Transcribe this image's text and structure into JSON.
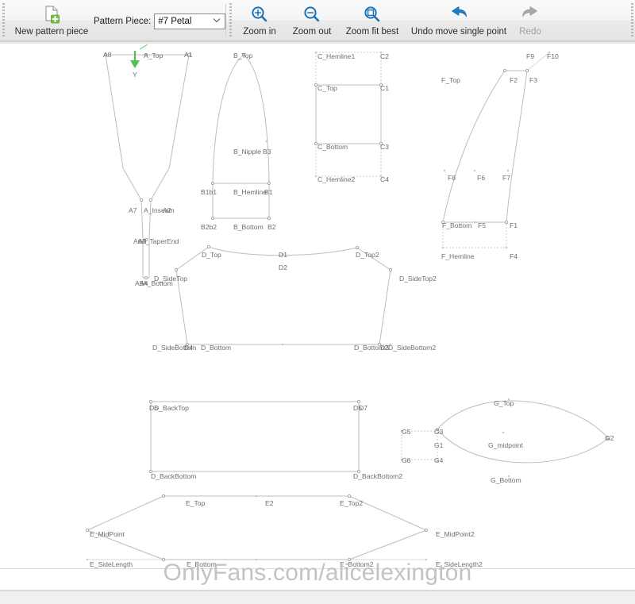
{
  "toolbar": {
    "new_piece": {
      "label": "New pattern piece",
      "icon": "new-page-plus-icon"
    },
    "piece_selector": {
      "label": "Pattern Piece:",
      "value": "#7 Petal",
      "caret_icon": "chevron-down-icon"
    },
    "zoom_in": {
      "label": "Zoom in",
      "icon": "magnifier-plus-icon"
    },
    "zoom_out": {
      "label": "Zoom out",
      "icon": "magnifier-minus-icon"
    },
    "zoom_fit": {
      "label": "Zoom fit best",
      "icon": "magnifier-fit-icon"
    },
    "undo": {
      "label": "Undo move single point",
      "icon": "undo-arrow-icon",
      "enabled": true
    },
    "redo": {
      "label": "Redo",
      "icon": "redo-arrow-icon",
      "enabled": false
    }
  },
  "colors": {
    "accent_blue": "#1a73b8",
    "disabled_gray": "#a2a2a2",
    "seam_line": "#bdbdbd",
    "label_text": "#6e6e6e",
    "axis_green": "#4fc24f",
    "watermark": "#c3c3c3"
  },
  "canvas": {
    "axis_marker": {
      "name": "Y",
      "direction": "down",
      "color": "#4fc24f"
    },
    "watermark": "OnlyFans.com/alicelexington",
    "labels": {
      "a": [
        "A8",
        "A_Top",
        "A1",
        "A7",
        "A_Inseam",
        "A2",
        "A6",
        "A3",
        "A_TaperEnd",
        "A5",
        "A4",
        "A_Bottom"
      ],
      "b": [
        "B_Top",
        "B_Nipple",
        "B3",
        "B1b1",
        "B_Hemline",
        "B1",
        "B2b2",
        "B_Bottom",
        "B2"
      ],
      "c": [
        "C_Hemline1",
        "C2",
        "C_Top",
        "C1",
        "C_Bottom",
        "C3",
        "C_Hemline2",
        "C4"
      ],
      "f": [
        "F9",
        "F10",
        "F_Top",
        "F2",
        "F3",
        "F8",
        "F6",
        "F7",
        "F_Bottom",
        "F5",
        "F1",
        "F_Hemline",
        "F4"
      ],
      "d": [
        "D_Top",
        "D1",
        "D_Top2",
        "D2",
        "D_SideTop",
        "D_SideTop2",
        "D_SideBottom",
        "D4",
        "D_Bottom",
        "D_Bottom2",
        "D3",
        "D_SideBottom2"
      ],
      "dback": [
        "D6",
        "D_BackTop",
        "D5",
        "D7",
        "D_BackBottom",
        "D_BackBottom2"
      ],
      "g": [
        "G5",
        "G3",
        "G1",
        "G6",
        "G4",
        "G_Top",
        "G_midpoint",
        "G2",
        "G_Bottom"
      ],
      "e": [
        "E_Top",
        "E2",
        "E_Top2",
        "E_MidPoint",
        "E_MidPoint2",
        "E_SideLength",
        "E_Bottom",
        "E_Bottom2",
        "E_SideLength2"
      ]
    }
  }
}
